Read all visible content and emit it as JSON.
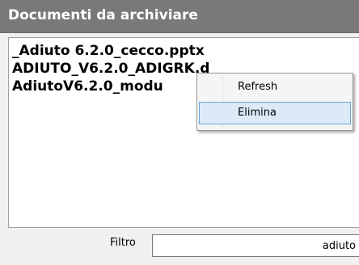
{
  "panel": {
    "title": "Documenti da archiviare"
  },
  "files": [
    {
      "name": "_Adiuto 6.2.0_cecco.pptx"
    },
    {
      "name": "ADIUTO_V6.2.0_ADIGRK.d"
    },
    {
      "name": "AdiutoV6.2.0_modu"
    }
  ],
  "filter": {
    "label": "Filtro",
    "value": "adiuto"
  },
  "context_menu": {
    "items": [
      {
        "label": "Refresh"
      },
      {
        "label": "Elimina"
      }
    ],
    "highlighted_index": 1
  },
  "colors": {
    "header_bg": "#797979",
    "menu_highlight_bg": "#dceaf8",
    "menu_highlight_border": "#6aa1d8"
  }
}
